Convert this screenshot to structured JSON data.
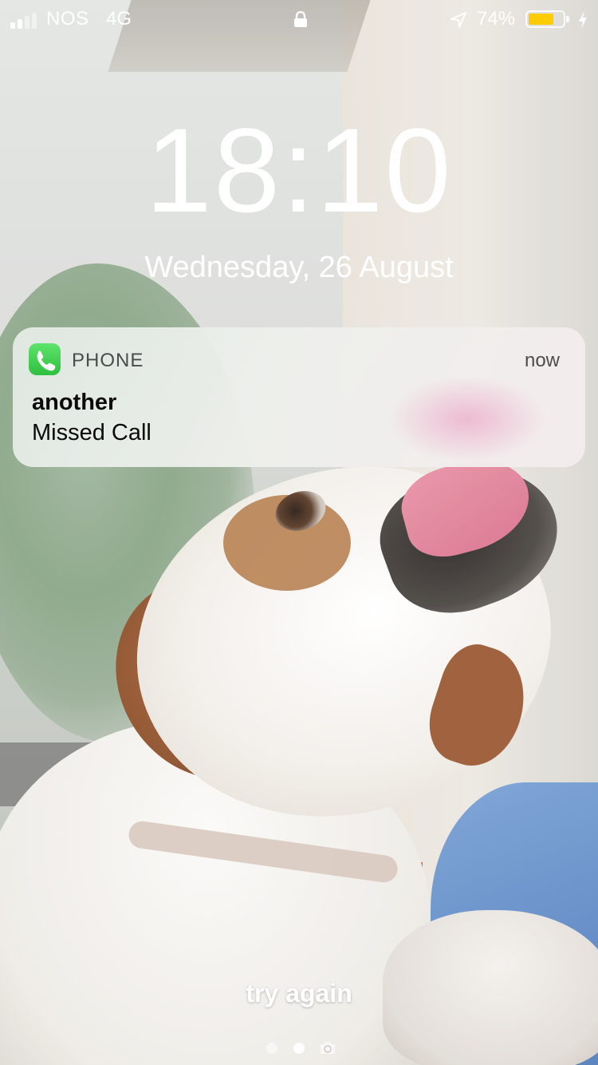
{
  "status_bar": {
    "carrier": "NOS",
    "network": "4G",
    "signal_bars_filled": 2,
    "signal_bars_total": 4,
    "lock_icon": "lock-icon",
    "location_icon": "location-arrow-icon",
    "battery_percent": "74%",
    "battery_level": 0.74,
    "battery_color": "#ffcc00",
    "charging_icon": "bolt-icon"
  },
  "lock_screen": {
    "time": "18:10",
    "date": "Wednesday, 26 August"
  },
  "notification": {
    "app_icon": "phone-app-icon",
    "app_name": "PHONE",
    "time": "now",
    "title": "another",
    "body": "Missed Call",
    "app_color": "#34c759"
  },
  "caption": "try again",
  "pager": {
    "pages": 2,
    "current": 1,
    "camera_icon": "camera-icon"
  }
}
